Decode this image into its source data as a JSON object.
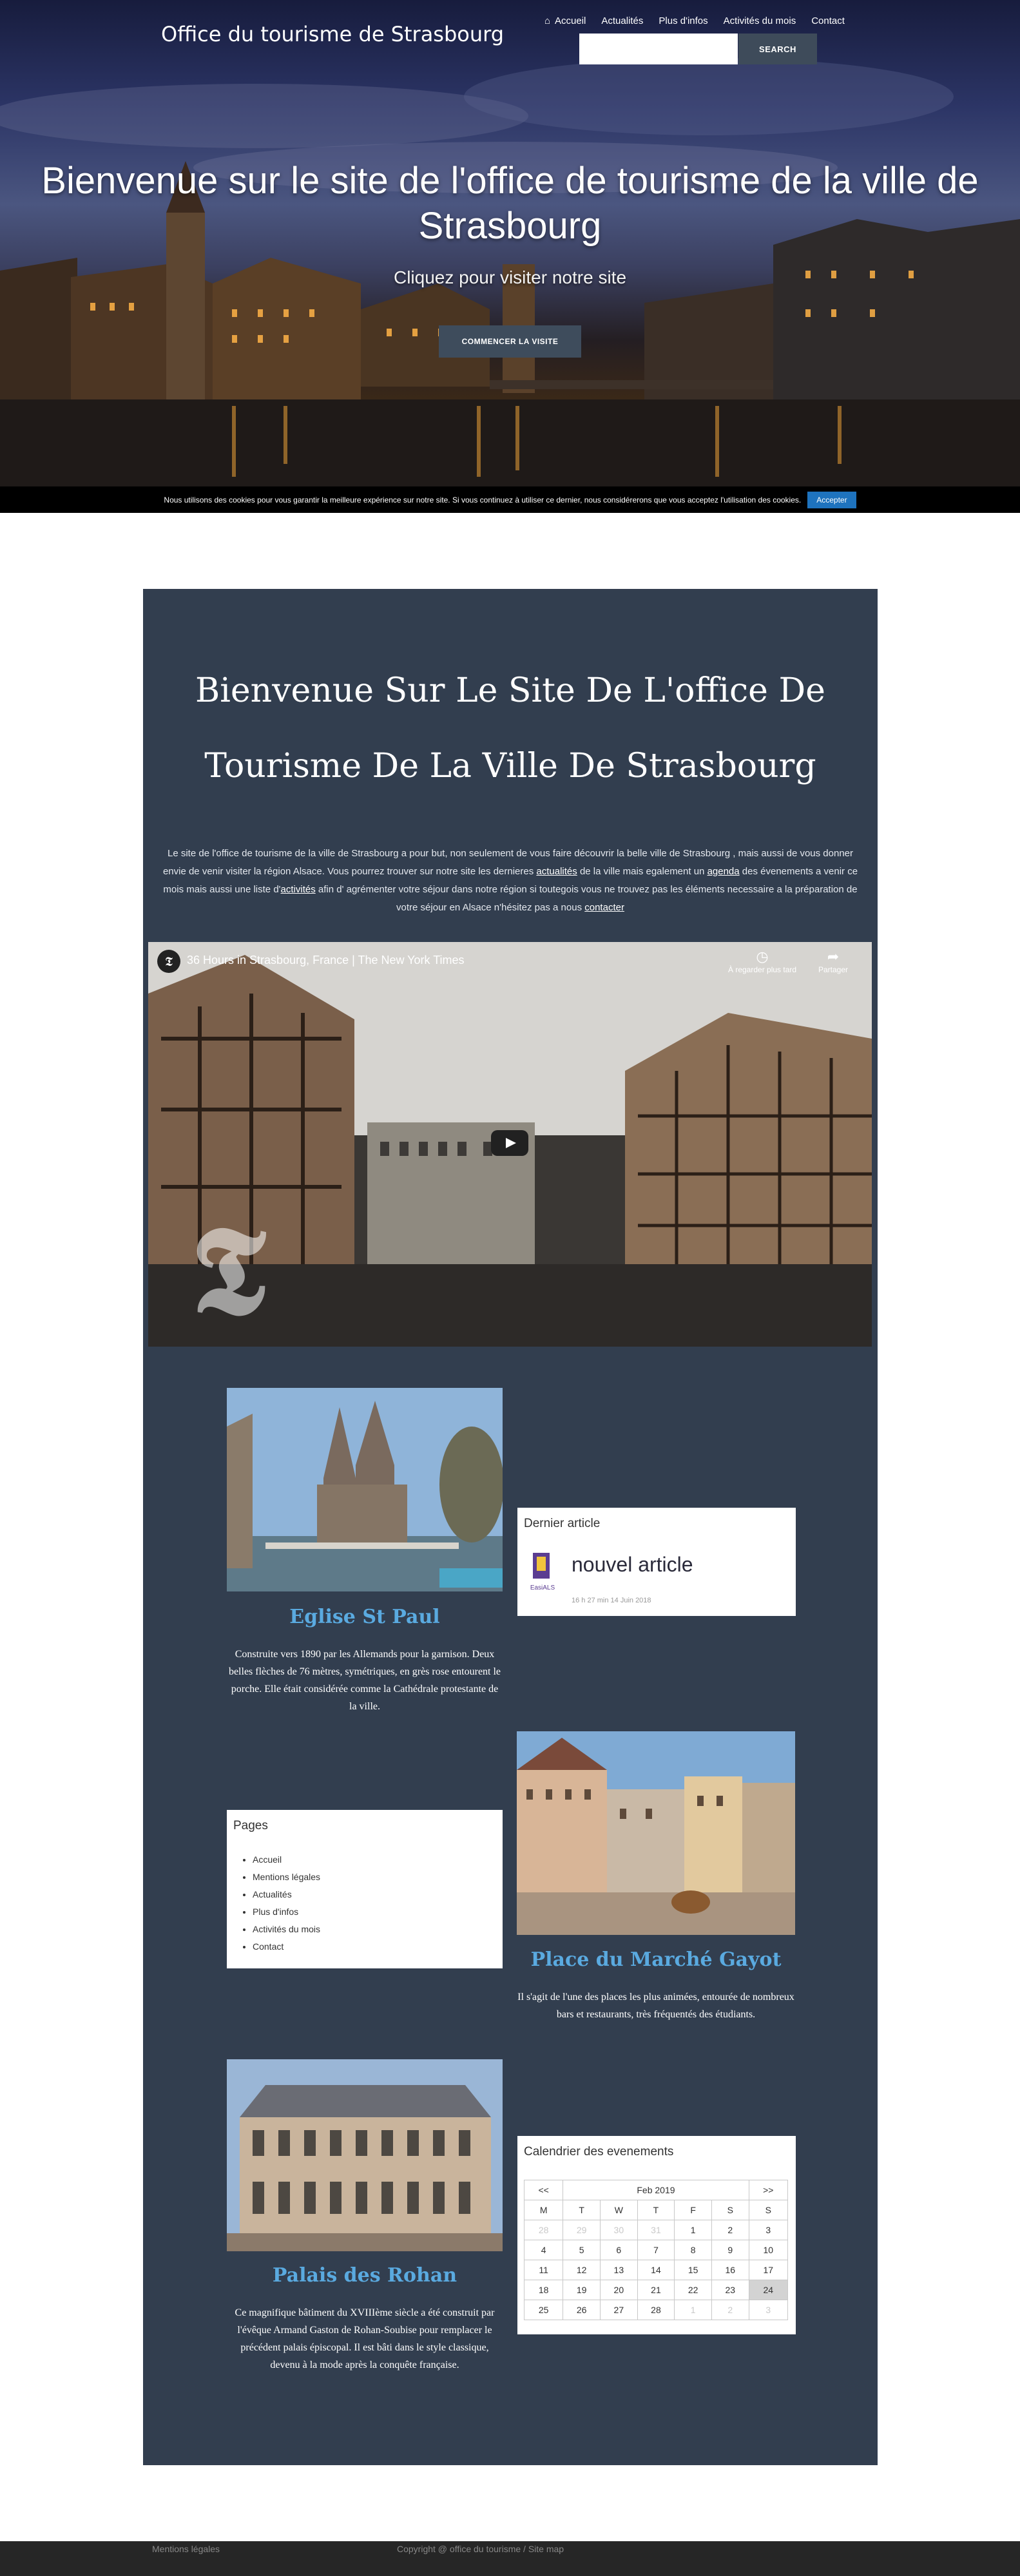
{
  "header": {
    "site_title": "Office du tourisme de Strasbourg",
    "nav": [
      {
        "label": "Accueil",
        "icon": "home-icon"
      },
      {
        "label": "Actualités"
      },
      {
        "label": "Plus d'infos"
      },
      {
        "label": "Activités du mois"
      },
      {
        "label": "Contact"
      }
    ],
    "search_placeholder": "",
    "search_button": "SEARCH"
  },
  "hero": {
    "title": "Bienvenue sur le site de l'office de tourisme de la ville de Strasbourg",
    "subtitle": "Cliquez pour visiter notre site",
    "button": "COMMENCER LA VISITE"
  },
  "cookie": {
    "text": "Nous utilisons des cookies pour vous garantir la meilleure expérience sur notre site. Si vous continuez à utiliser ce dernier, nous considérerons que vous acceptez l'utilisation des cookies.",
    "button": "Accepter"
  },
  "main": {
    "title": "Bienvenue Sur Le Site De L'office De Tourisme De La Ville De Strasbourg",
    "intro": {
      "p1": "Le site de l'office de tourisme de la ville de Strasbourg a pour but, non seulement de vous faire découvrir la belle ville de Strasbourg , mais aussi de vous donner envie de venir visiter la région Alsace. Vous pourrez trouver sur notre site les dernieres ",
      "link_actualites": "actualités",
      "p2": " de la ville mais egalement un ",
      "link_agenda": "agenda",
      "p3": " des évenements a venir ce mois mais aussi une liste d'",
      "link_activites": "activités",
      "p4": " afin d' agrémenter votre séjour dans notre région si toutegois vous ne trouvez pas les  éléments necessaire a la préparation de votre séjour en Alsace n'hésitez pas a nous ",
      "link_contacter": "contacter"
    },
    "video": {
      "title": "36 Hours in Strasbourg, France | The New York Times",
      "watch_later": "À regarder plus tard",
      "share": "Partager"
    },
    "cards": [
      {
        "title": "Eglise St Paul",
        "text": "Construite vers 1890 par les Allemands pour la garnison. Deux belles flèches de 76 mètres, symétriques, en grès rose entourent le porche. Elle était considérée comme la Cathédrale protestante de la ville."
      },
      {
        "title": "Place du Marché Gayot",
        "text": "Il s'agit de l'une des places les plus animées, entourée de nombreux bars et restaurants, très fréquentés des étudiants."
      },
      {
        "title": "Palais des Rohan",
        "text": "Ce magnifique bâtiment du XVIIIème siècle a été construit par l'évêque Armand Gaston de Rohan-Soubise pour remplacer le précédent palais épiscopal. Il est bâti dans le style classique, devenu à la mode après la conquête française."
      }
    ],
    "last_article": {
      "heading": "Dernier article",
      "title": "nouvel article",
      "logo_text": "EasiALS",
      "meta": "16 h 27 min 14 Juin 2018"
    },
    "pages_widget": {
      "heading": "Pages",
      "items": [
        "Accueil",
        "Mentions légales",
        "Actualités",
        "Plus d'infos",
        "Activités du mois",
        "Contact"
      ]
    },
    "calendar": {
      "heading": "Calendrier des evenements",
      "prev": "<<",
      "next": ">>",
      "month": "Feb 2019",
      "weekdays": [
        "M",
        "T",
        "W",
        "T",
        "F",
        "S",
        "S"
      ],
      "weeks": [
        [
          "28",
          "29",
          "30",
          "31",
          "1",
          "2",
          "3"
        ],
        [
          "4",
          "5",
          "6",
          "7",
          "8",
          "9",
          "10"
        ],
        [
          "11",
          "12",
          "13",
          "14",
          "15",
          "16",
          "17"
        ],
        [
          "18",
          "19",
          "20",
          "21",
          "22",
          "23",
          "24"
        ],
        [
          "25",
          "26",
          "27",
          "28",
          "1",
          "2",
          "3"
        ]
      ]
    }
  },
  "footer": {
    "left": "Mentions légales",
    "center": "Copyright @ office du tourisme  /  Site map"
  },
  "colors": {
    "panel": "#323e4f",
    "card_title": "#5aaae0",
    "accept": "#1e73be"
  }
}
